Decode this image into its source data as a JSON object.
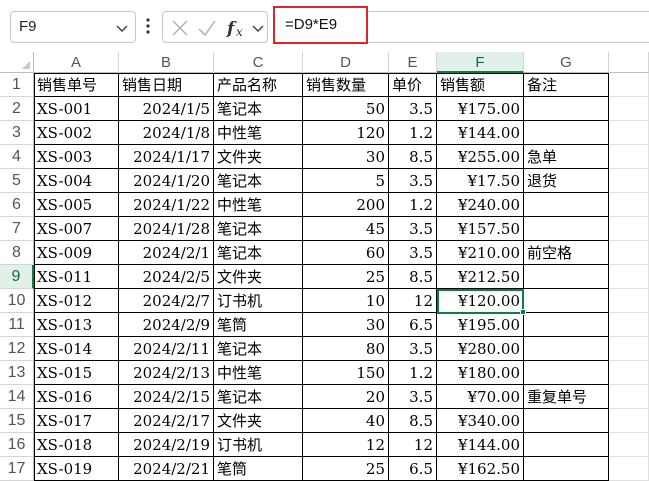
{
  "formula_bar": {
    "name_box": "F9",
    "formula": "=D9*E9"
  },
  "columns": [
    "A",
    "B",
    "C",
    "D",
    "E",
    "F",
    "G"
  ],
  "rows": [
    {
      "n": "1",
      "cells": [
        "销售单号",
        "销售日期",
        "产品名称",
        "销售数量",
        "单价",
        "销售额",
        "备注"
      ]
    },
    {
      "n": "2",
      "cells": [
        "XS-001",
        "2024/1/5",
        "笔记本",
        "50",
        "3.5",
        "¥175.00",
        ""
      ]
    },
    {
      "n": "3",
      "cells": [
        "XS-002",
        "2024/1/8",
        "中性笔",
        "120",
        "1.2",
        "¥144.00",
        ""
      ]
    },
    {
      "n": "4",
      "cells": [
        "XS-003",
        "2024/1/17",
        "文件夹",
        "30",
        "8.5",
        "¥255.00",
        "急单"
      ]
    },
    {
      "n": "5",
      "cells": [
        "XS-004",
        "2024/1/20",
        "笔记本",
        "5",
        "3.5",
        "¥17.50",
        "退货"
      ]
    },
    {
      "n": "6",
      "cells": [
        "XS-005",
        "2024/1/22",
        "中性笔",
        "200",
        "1.2",
        "¥240.00",
        ""
      ]
    },
    {
      "n": "7",
      "cells": [
        "XS-007",
        "2024/1/28",
        "笔记本",
        "45",
        "3.5",
        "¥157.50",
        ""
      ]
    },
    {
      "n": "8",
      "cells": [
        "XS-009",
        "2024/2/1",
        "笔记本",
        "60",
        "3.5",
        "¥210.00",
        "前空格"
      ]
    },
    {
      "n": "9",
      "cells": [
        "XS-011",
        "2024/2/5",
        "文件夹",
        "25",
        "8.5",
        "¥212.50",
        ""
      ]
    },
    {
      "n": "10",
      "cells": [
        "XS-012",
        "2024/2/7",
        "订书机",
        "10",
        "12",
        "¥120.00",
        ""
      ]
    },
    {
      "n": "11",
      "cells": [
        "XS-013",
        "2024/2/9",
        "笔筒",
        "30",
        "6.5",
        "¥195.00",
        ""
      ]
    },
    {
      "n": "12",
      "cells": [
        "XS-014",
        "2024/2/11",
        "笔记本",
        "80",
        "3.5",
        "¥280.00",
        ""
      ]
    },
    {
      "n": "13",
      "cells": [
        "XS-015",
        "2024/2/13",
        "中性笔",
        "150",
        "1.2",
        "¥180.00",
        ""
      ]
    },
    {
      "n": "14",
      "cells": [
        "XS-016",
        "2024/2/15",
        "笔记本",
        "20",
        "3.5",
        "¥70.00",
        "重复单号"
      ]
    },
    {
      "n": "15",
      "cells": [
        "XS-017",
        "2024/2/17",
        "文件夹",
        "40",
        "8.5",
        "¥340.00",
        ""
      ]
    },
    {
      "n": "16",
      "cells": [
        "XS-018",
        "2024/2/19",
        "订书机",
        "12",
        "12",
        "¥144.00",
        ""
      ]
    },
    {
      "n": "17",
      "cells": [
        "XS-019",
        "2024/2/21",
        "笔筒",
        "25",
        "6.5",
        "¥162.50",
        ""
      ]
    }
  ],
  "selection": {
    "column": "F",
    "row": "9"
  },
  "colors": {
    "accent": "#107c41",
    "highlight": "#d9262e",
    "header_selected_bg": "#e1f0e8"
  }
}
